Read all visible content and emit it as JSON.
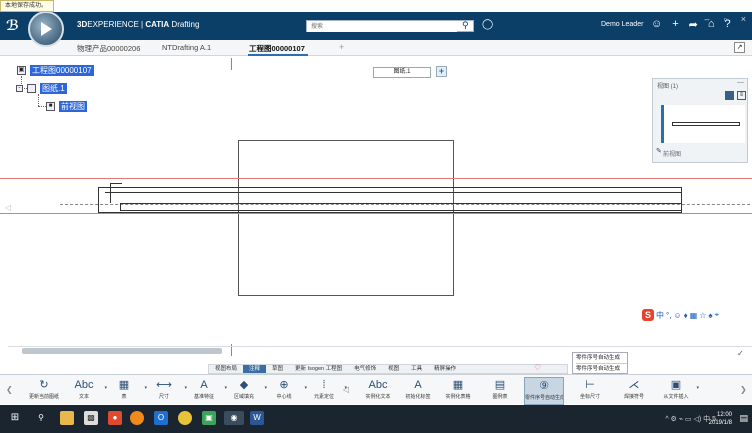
{
  "notification": "本地保存成功。",
  "header": {
    "brand_prefix": "3D",
    "brand_mid": "EXPERIENCE | ",
    "brand_app": "CATIA",
    "brand_suffix": " Drafting",
    "search_placeholder": "搜索",
    "user": "Demo Leader",
    "window_controls": [
      "–",
      "▫",
      "×"
    ]
  },
  "tabs": [
    {
      "label": "物理产品00000206"
    },
    {
      "label": "NTDrafting A.1"
    },
    {
      "label": "工程图00000107",
      "active": true
    },
    {
      "label": "+"
    }
  ],
  "tree": {
    "root": "工程图00000107",
    "sheet": "图纸.1",
    "view": "前视图"
  },
  "sheet_tab": "图纸.1",
  "views_panel": {
    "title": "视图 (1)",
    "item_label": "前视图"
  },
  "ime": [
    "中",
    "°,",
    "☺",
    "♦",
    "▦",
    "☆",
    "♠",
    "⌖"
  ],
  "command_tabs": [
    {
      "label": "视图布局"
    },
    {
      "label": "注释",
      "active": true
    },
    {
      "label": "草图"
    },
    {
      "label": "更新 Isogen 工程图"
    },
    {
      "label": "电气修饰"
    },
    {
      "label": "视图"
    },
    {
      "label": "工具"
    },
    {
      "label": "精屏操作"
    }
  ],
  "tooltip": [
    "零件序号自动生成",
    "零件序号自动生成"
  ],
  "tools": [
    {
      "label": "更新当前图纸",
      "icon": "↻"
    },
    {
      "label": "文本",
      "icon": "Abc"
    },
    {
      "label": "表",
      "icon": "▦"
    },
    {
      "label": "尺寸",
      "icon": "⟷"
    },
    {
      "label": "基准特征",
      "icon": "A"
    },
    {
      "label": "区域填充",
      "icon": "◆"
    },
    {
      "label": "中心线",
      "icon": "⊕"
    },
    {
      "label": "元素定位",
      "icon": "⁞"
    },
    {
      "label": "实例化文本",
      "icon": "Abc"
    },
    {
      "label": "初始化标签",
      "icon": "A"
    },
    {
      "label": "实例化表格",
      "icon": "▦"
    },
    {
      "label": "图例表",
      "icon": "▤"
    },
    {
      "label": "零件序号自动生成",
      "icon": "⑨"
    },
    {
      "label": "坐标尺寸",
      "icon": "⊢"
    },
    {
      "label": "焊接符号",
      "icon": "⋌"
    },
    {
      "label": "从文件插入",
      "icon": "▣"
    }
  ],
  "taskbar": {
    "time": "12:00",
    "date": "2019/1/8",
    "tray": "^ ⚙ ⌁ ▭ ◁) 中 5"
  }
}
